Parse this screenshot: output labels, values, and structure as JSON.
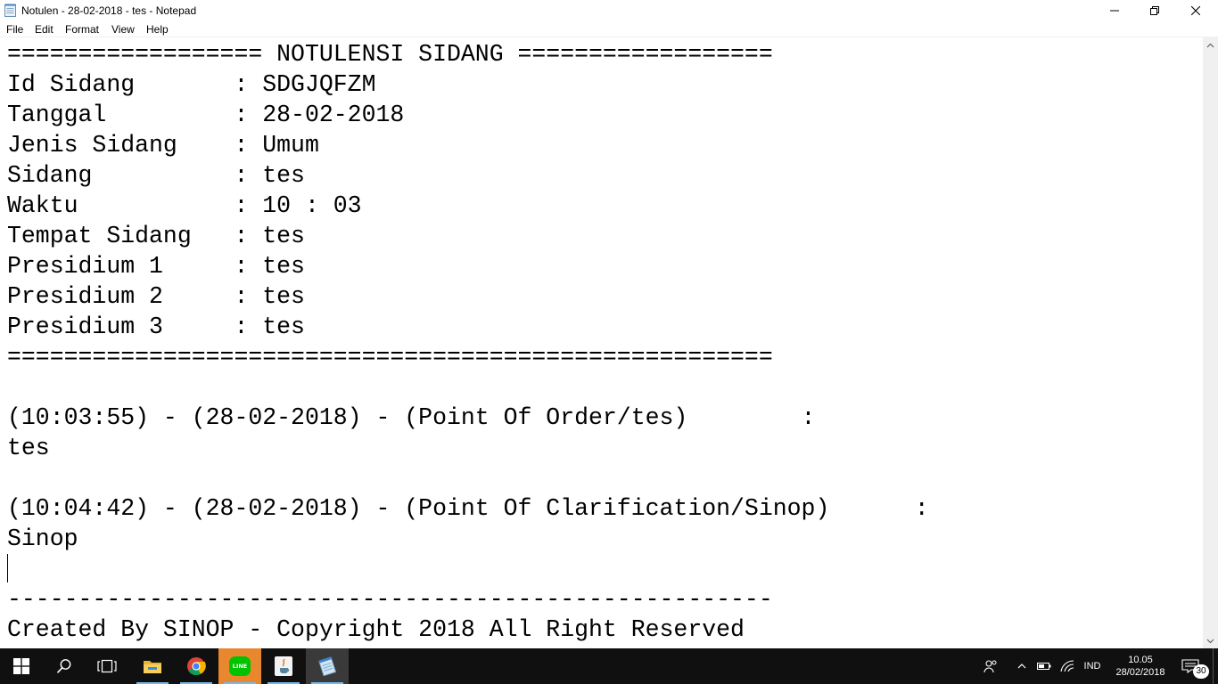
{
  "window": {
    "title": "Notulen - 28-02-2018 - tes - Notepad"
  },
  "menu": [
    {
      "label": "File"
    },
    {
      "label": "Edit"
    },
    {
      "label": "Format"
    },
    {
      "label": "View"
    },
    {
      "label": "Help"
    }
  ],
  "document": {
    "lines": [
      "================== NOTULENSI SIDANG ==================",
      "Id Sidang       : SDGJQFZM",
      "Tanggal         : 28-02-2018",
      "Jenis Sidang    : Umum",
      "Sidang          : tes",
      "Waktu           : 10 : 03",
      "Tempat Sidang   : tes",
      "Presidium 1     : tes",
      "Presidium 2     : tes",
      "Presidium 3     : tes",
      "======================================================",
      "",
      "(10:03:55) - (28-02-2018) - (Point Of Order/tes)        :",
      "tes",
      "",
      "(10:04:42) - (28-02-2018) - (Point Of Clarification/Sinop)      :",
      "Sinop",
      "",
      "------------------------------------------------------",
      "Created By SINOP - Copyright 2018 All Right Reserved"
    ]
  },
  "taskbar": {
    "apps": [
      {
        "name": "file-explorer",
        "icon": "folder-icon"
      },
      {
        "name": "chrome",
        "icon": "chrome-icon"
      },
      {
        "name": "line",
        "icon": "line-icon",
        "icon_text": "LINE"
      },
      {
        "name": "java",
        "icon": "java-icon"
      },
      {
        "name": "notepad",
        "icon": "notepad-icon"
      }
    ],
    "tray": {
      "language": "IND",
      "time": "10.05",
      "date": "28/02/2018",
      "notification_count": "30"
    }
  },
  "colors": {
    "taskbar_bg": "#101010",
    "accent": "#76b9ed",
    "line_green": "#00c300",
    "line_orange": "#e8872e"
  }
}
